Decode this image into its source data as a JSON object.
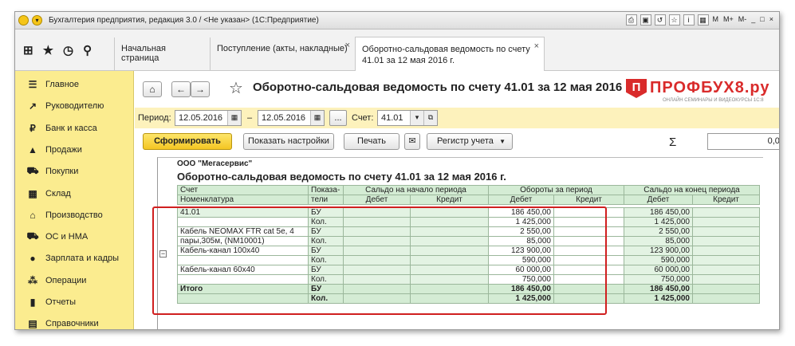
{
  "window": {
    "title": "Бухгалтерия предприятия, редакция 3.0 / <Не указан> (1С:Предприятие)",
    "controls": [
      "M",
      "M+",
      "M-",
      "_",
      "□",
      "×"
    ]
  },
  "tabs": [
    {
      "label": "Начальная страница"
    },
    {
      "label": "Поступление (акты, накладные)"
    },
    {
      "label": "Оборотно-сальдовая ведомость по счету 41.01 за 12 мая 2016 г."
    }
  ],
  "sidebar": {
    "items": [
      {
        "label": "Главное",
        "icon": "menu-icon"
      },
      {
        "label": "Руководителю",
        "icon": "chart-icon"
      },
      {
        "label": "Банк и касса",
        "icon": "coin-icon"
      },
      {
        "label": "Продажи",
        "icon": "bag-icon"
      },
      {
        "label": "Покупки",
        "icon": "cart-icon"
      },
      {
        "label": "Склад",
        "icon": "warehouse-icon"
      },
      {
        "label": "Производство",
        "icon": "factory-icon"
      },
      {
        "label": "ОС и НМА",
        "icon": "truck-icon"
      },
      {
        "label": "Зарплата и кадры",
        "icon": "person-icon"
      },
      {
        "label": "Операции",
        "icon": "operations-icon"
      },
      {
        "label": "Отчеты",
        "icon": "report-icon"
      },
      {
        "label": "Справочники",
        "icon": "book-icon"
      }
    ]
  },
  "document": {
    "title": "Оборотно-сальдовая ведомость по счету 41.01 за 12 мая 2016 г."
  },
  "brand": {
    "name": "ПРОФБУХ8.ру",
    "tagline": "ОНЛАЙН СЕМИНАРЫ И ВИДЕОКУРСЫ 1С:8"
  },
  "filters": {
    "period_label": "Период:",
    "date_from": "12.05.2016",
    "dash": "–",
    "date_to": "12.05.2016",
    "ellipsis": "...",
    "account_label": "Счет:",
    "account": "41.01"
  },
  "toolbar": {
    "generate": "Сформировать",
    "settings": "Показать настройки",
    "print": "Печать",
    "register": "Регистр учета",
    "sum_value": "0,00"
  },
  "report": {
    "org": "ООО \"Мегасервис\"",
    "title": "Оборотно-сальдовая ведомость по счету 41.01 за 12 мая 2016 г.",
    "headers": {
      "account": "Счет",
      "nomenclature": "Номенклатура",
      "indicators_1": "Показа-",
      "indicators_2": "тели",
      "opening": "Сальдо на начало периода",
      "turnover": "Обороты за период",
      "closing": "Сальдо на конец периода",
      "debit": "Дебет",
      "credit": "Кредит"
    },
    "rows": [
      {
        "name": "41.01",
        "ind": "БУ",
        "open_d": "",
        "open_c": "",
        "turn_d": "186 450,00",
        "turn_c": "",
        "close_d": "186 450,00",
        "close_c": ""
      },
      {
        "name": "",
        "ind": "Кол.",
        "open_d": "",
        "open_c": "",
        "turn_d": "1 425,000",
        "turn_c": "",
        "close_d": "1 425,000",
        "close_c": ""
      },
      {
        "name": "Кабель NEOMAX FTR cat 5e, 4",
        "ind": "БУ",
        "open_d": "",
        "open_c": "",
        "turn_d": "2 550,00",
        "turn_c": "",
        "close_d": "2 550,00",
        "close_c": ""
      },
      {
        "name": "пары,305м, (NM10001)",
        "ind": "Кол.",
        "open_d": "",
        "open_c": "",
        "turn_d": "85,000",
        "turn_c": "",
        "close_d": "85,000",
        "close_c": ""
      },
      {
        "name": "Кабель-канал 100х40",
        "ind": "БУ",
        "open_d": "",
        "open_c": "",
        "turn_d": "123 900,00",
        "turn_c": "",
        "close_d": "123 900,00",
        "close_c": ""
      },
      {
        "name": "",
        "ind": "Кол.",
        "open_d": "",
        "open_c": "",
        "turn_d": "590,000",
        "turn_c": "",
        "close_d": "590,000",
        "close_c": ""
      },
      {
        "name": "Кабель-канал 60х40",
        "ind": "БУ",
        "open_d": "",
        "open_c": "",
        "turn_d": "60 000,00",
        "turn_c": "",
        "close_d": "60 000,00",
        "close_c": ""
      },
      {
        "name": "",
        "ind": "Кол.",
        "open_d": "",
        "open_c": "",
        "turn_d": "750,000",
        "turn_c": "",
        "close_d": "750,000",
        "close_c": ""
      }
    ],
    "totals": [
      {
        "name": "Итого",
        "ind": "БУ",
        "turn_d": "186 450,00",
        "close_d": "186 450,00"
      },
      {
        "name": "",
        "ind": "Кол.",
        "turn_d": "1 425,000",
        "close_d": "1 425,000"
      }
    ]
  }
}
